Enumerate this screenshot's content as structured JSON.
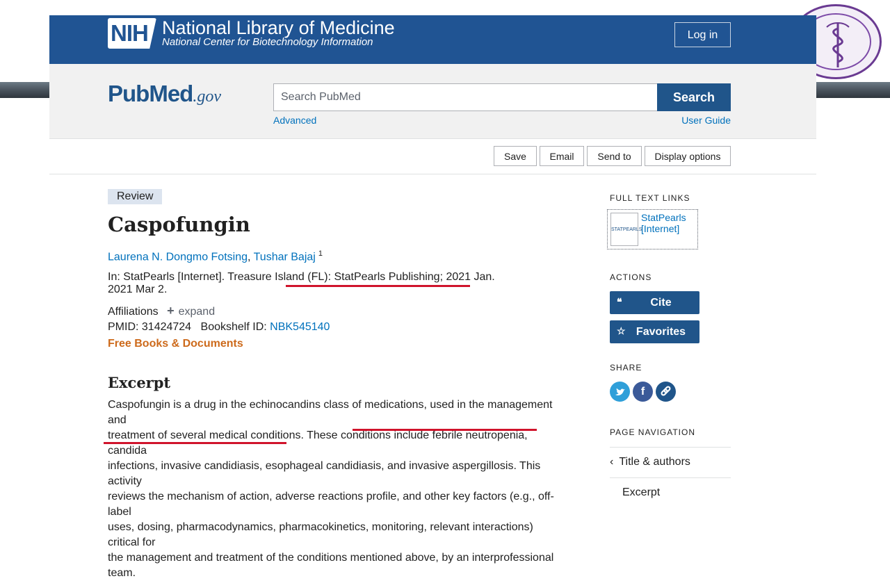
{
  "header": {
    "nih_logo": "NIH",
    "title": "National Library of Medicine",
    "subtitle": "National Center for Biotechnology Information",
    "login_label": "Log in"
  },
  "search": {
    "logo_pub": "Pub",
    "logo_med": "Med",
    "logo_gov": ".gov",
    "placeholder": "Search PubMed",
    "button_label": "Search",
    "advanced_label": "Advanced",
    "guide_label": "User Guide"
  },
  "toolbar": {
    "buttons": [
      "Save",
      "Email",
      "Send to",
      "Display options"
    ]
  },
  "article": {
    "badge": "Review",
    "title": "Caspofungin",
    "authors": [
      "Laurena N. Dongmo Fotsing",
      "Tushar Bajaj"
    ],
    "author_sep": ", ",
    "author_sup": "1",
    "citation_line1": "In: StatPearls [Internet]. Treasure Island (FL): StatPearls Publishing; 2021 Jan.",
    "citation_line2": "2021 Mar 2.",
    "affiliations_label": "Affiliations",
    "expand_label": "expand",
    "pmid": "PMID: 31424724",
    "bookshelf_label": "Bookshelf ID: ",
    "bookshelf_id": "NBK545140",
    "free_label": "Free Books & Documents",
    "excerpt_heading": "Excerpt",
    "excerpt_lines": [
      "Caspofungin is a drug in the echinocandins class of medications, used in the management and",
      "treatment of several medical conditions. These conditions include febrile neutropenia, candida",
      "infections, invasive candidiasis, esophageal candidiasis, and invasive aspergillosis. This activity",
      "reviews the mechanism of action, adverse reactions profile, and other key factors (e.g., off-label",
      "uses, dosing, pharmacodynamics, pharmacokinetics, monitoring, relevant interactions) critical for",
      "the management and treatment of the conditions mentioned above, by an interprofessional team."
    ]
  },
  "sidebar": {
    "full_text_label": "FULL TEXT LINKS",
    "ftl_logo": "STATPEARLS",
    "ftl_link": "StatPearls [Internet]",
    "actions_label": "ACTIONS",
    "cite_label": "Cite",
    "favorites_label": "Favorites",
    "share_label": "SHARE",
    "page_nav_label": "PAGE NAVIGATION",
    "nav_items": [
      "Title & authors",
      "Excerpt"
    ]
  },
  "colors": {
    "nih_blue": "#205493",
    "link_blue": "#0071bc",
    "free_orange": "#cd6a1b",
    "underline_red": "#d0142c",
    "twitter": "#2f9fd9",
    "facebook": "#3b5a99",
    "link_share": "#20558a"
  }
}
